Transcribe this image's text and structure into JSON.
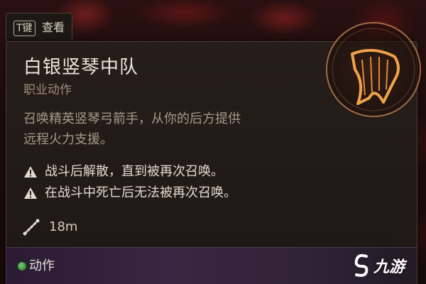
{
  "tooltip": {
    "key_hint": {
      "key": "T键",
      "label": "查看"
    },
    "title": "白银竖琴中队",
    "subtitle": "职业动作",
    "description_lines": [
      "召唤精英竖琴弓箭手，从你的后方提供",
      "远程火力支援。"
    ],
    "notes": [
      "战斗后解散，直到被再次召唤。",
      "在战斗中死亡后无法被再次召唤。"
    ],
    "range": "18m",
    "footer_label": "动作"
  },
  "watermark": {
    "text": "九游"
  },
  "colors": {
    "accent_orange": "#e08a3a",
    "footer_purple": "#3a2642",
    "action_green": "#4caf50"
  },
  "icons": {
    "warning": "warning-triangle-icon",
    "range": "range-ruler-icon",
    "emblem": "harp-spell-icon",
    "action_dot": "action-resource-dot-icon"
  }
}
